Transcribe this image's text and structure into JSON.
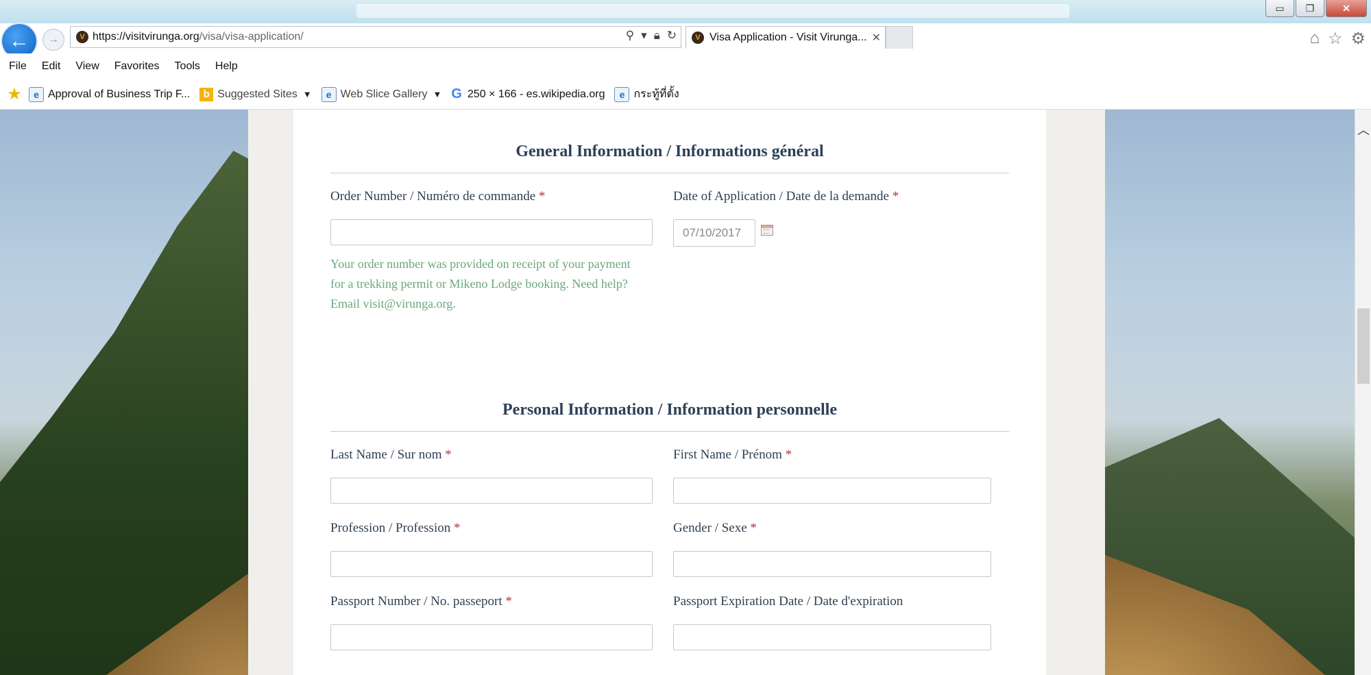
{
  "browser": {
    "url_host": "https://visitvirunga.org",
    "url_path": "/visa/visa-application/",
    "tab_title": "Visa Application - Visit Virunga...",
    "window_controls": {
      "minimize": "▭",
      "restore": "❐",
      "close": "✕"
    }
  },
  "menu": [
    "File",
    "Edit",
    "View",
    "Favorites",
    "Tools",
    "Help"
  ],
  "favorites": [
    {
      "label": "Approval of Business Trip F...",
      "icon": "ie-icon"
    },
    {
      "label": "Suggested Sites",
      "icon": "bing-icon",
      "dropdown": true
    },
    {
      "label": "Web Slice Gallery",
      "icon": "ie-icon",
      "dropdown": true
    },
    {
      "label": "250 × 166 - es.wikipedia.org",
      "icon": "google-icon"
    },
    {
      "label": "กระทู้ที่ตั้ง",
      "icon": "ie-icon"
    }
  ],
  "form": {
    "general_title": "General Information / Informations général",
    "order_number_label": "Order Number / Numéro de commande",
    "order_number_value": "",
    "date_label": "Date of Application / Date de la demande",
    "date_value": "07/10/2017",
    "help_line1": "Your order number was provided on receipt of your payment",
    "help_line2": "for a trekking permit or Mikeno Lodge booking. Need help?",
    "help_line3": "Email visit@virunga.org.",
    "personal_title": "Personal Information / Information personnelle",
    "last_name_label": "Last Name / Sur nom",
    "first_name_label": "First Name / Prénom",
    "profession_label": "Profession / Profession",
    "gender_label": "Gender / Sexe",
    "passport_number_label": "Passport Number / No. passeport",
    "passport_expiry_label": "Passport Expiration Date / Date d'expiration",
    "required_mark": "*"
  },
  "colors": {
    "heading": "#2c4058",
    "required": "#b5383a",
    "help": "#6aa87a"
  }
}
